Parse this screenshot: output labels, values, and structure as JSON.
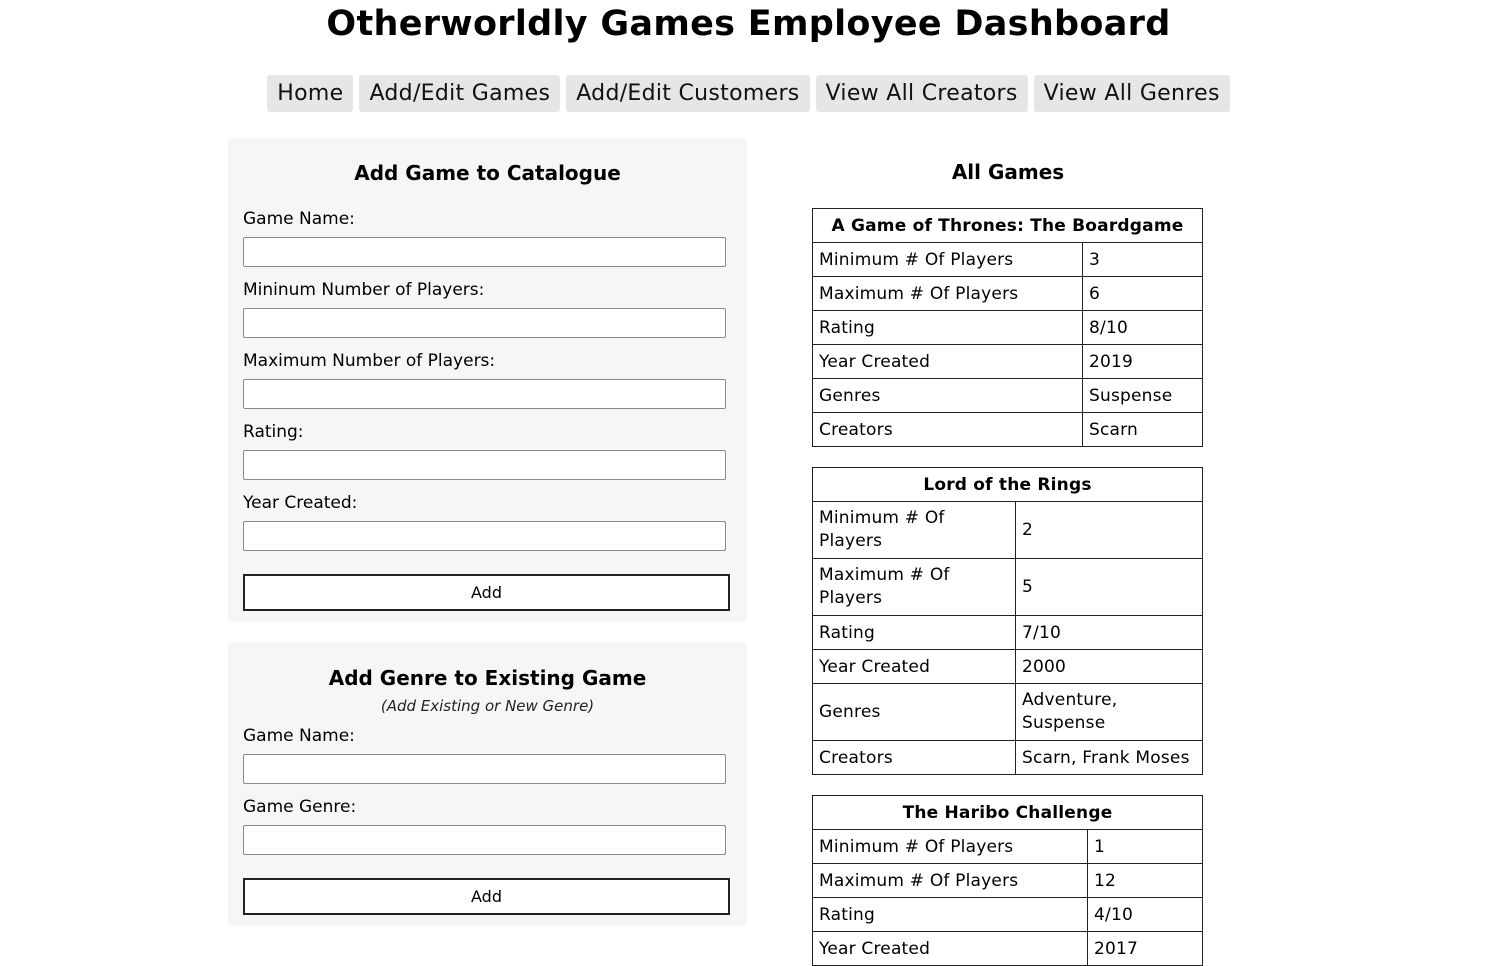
{
  "page": {
    "title": "Otherworldly Games Employee Dashboard"
  },
  "nav": [
    {
      "label": "Home"
    },
    {
      "label": "Add/Edit Games"
    },
    {
      "label": "Add/Edit Customers"
    },
    {
      "label": "View All Creators"
    },
    {
      "label": "View All Genres"
    }
  ],
  "add_game": {
    "heading": "Add Game to Catalogue",
    "fields": [
      {
        "label": "Game Name:",
        "value": ""
      },
      {
        "label": "Mininum Number of Players:",
        "value": ""
      },
      {
        "label": "Maximum Number of Players:",
        "value": ""
      },
      {
        "label": "Rating:",
        "value": ""
      },
      {
        "label": "Year Created:",
        "value": ""
      }
    ],
    "button": "Add"
  },
  "add_genre": {
    "heading": "Add Genre to Existing Game",
    "subheading": "(Add Existing or New Genre)",
    "fields": [
      {
        "label": "Game Name:",
        "value": ""
      },
      {
        "label": "Game Genre:",
        "value": ""
      }
    ],
    "button": "Add"
  },
  "all_games": {
    "heading": "All Games",
    "row_labels": {
      "min": "Minimum # Of Players",
      "max": "Maximum # Of Players",
      "rating": "Rating",
      "year": "Year Created",
      "genres": "Genres",
      "creators": "Creators"
    },
    "games": [
      {
        "name": "A Game of Thrones: The Boardgame",
        "min": "3",
        "max": "6",
        "rating": "8/10",
        "year": "2019",
        "genres": "Suspense",
        "creators": "Scarn"
      },
      {
        "name": "Lord of the Rings",
        "min": "2",
        "max": "5",
        "rating": "7/10",
        "year": "2000",
        "genres": "Adventure, Suspense",
        "creators": "Scarn, Frank Moses"
      },
      {
        "name": "The Haribo Challenge",
        "min": "1",
        "max": "12",
        "rating": "4/10",
        "year": "2017",
        "genres": "",
        "creators": ""
      }
    ]
  }
}
